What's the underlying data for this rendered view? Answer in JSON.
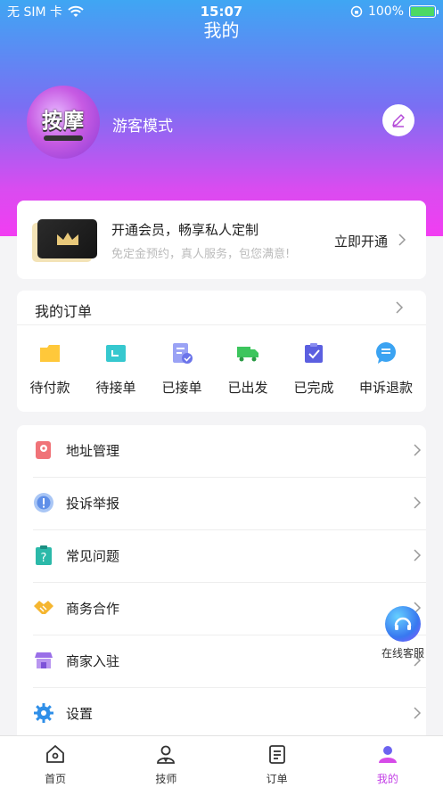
{
  "status_bar": {
    "carrier": "无 SIM 卡",
    "time": "15:07",
    "battery": "100%"
  },
  "page_title": "我的",
  "profile": {
    "avatar_text": "按摩",
    "nickname": "游客模式",
    "edit_icon": "pencil-icon"
  },
  "vip": {
    "title": "开通会员，畅享私人定制",
    "subtitle": "免定金预约，真人服务，包您满意!",
    "action": "立即开通"
  },
  "orders": {
    "header": "我的订单",
    "items": [
      {
        "label": "待付款",
        "icon": "wallet-icon",
        "color": "#ffc83a"
      },
      {
        "label": "待接单",
        "icon": "pending-icon",
        "color": "#36c8cf"
      },
      {
        "label": "已接单",
        "icon": "accepted-icon",
        "color": "#7a84f0"
      },
      {
        "label": "已出发",
        "icon": "truck-icon",
        "color": "#3cc55d"
      },
      {
        "label": "已完成",
        "icon": "completed-icon",
        "color": "#5b5fe0"
      },
      {
        "label": "申诉退款",
        "icon": "chat-icon",
        "color": "#3ba3f2"
      }
    ]
  },
  "menu": [
    {
      "label": "地址管理",
      "icon": "location-icon"
    },
    {
      "label": "投诉举报",
      "icon": "report-icon"
    },
    {
      "label": "常见问题",
      "icon": "question-icon"
    },
    {
      "label": "商务合作",
      "icon": "handshake-icon"
    },
    {
      "label": "商家入驻",
      "icon": "shop-icon"
    },
    {
      "label": "设置",
      "icon": "gear-icon"
    }
  ],
  "customer_service": {
    "label": "在线客服"
  },
  "tabbar": [
    {
      "label": "首页",
      "icon": "home-icon"
    },
    {
      "label": "技师",
      "icon": "technician-icon"
    },
    {
      "label": "订单",
      "icon": "order-icon"
    },
    {
      "label": "我的",
      "icon": "profile-icon",
      "active": true
    }
  ],
  "colors": {
    "accent": "#c33fe6",
    "gradient_top": "#3fa6f3",
    "gradient_bottom": "#f23df2"
  }
}
